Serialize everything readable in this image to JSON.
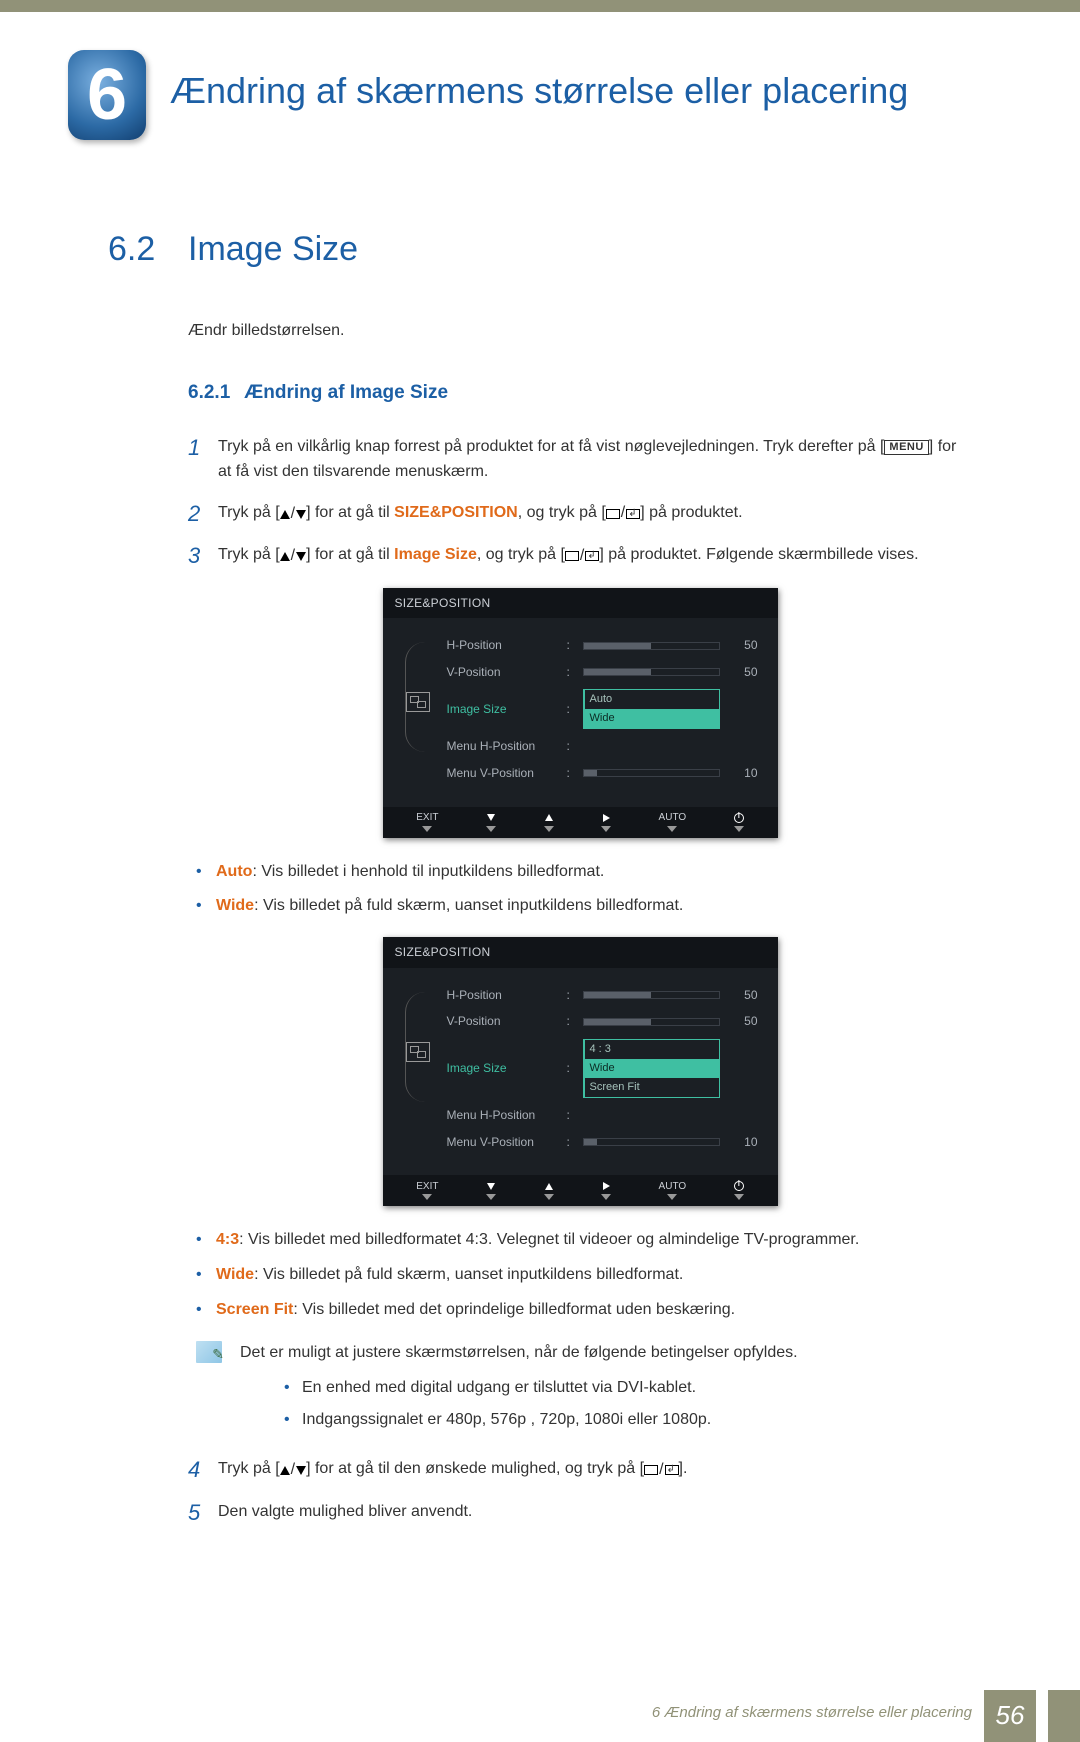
{
  "chapter": {
    "number": "6",
    "title": "Ændring af skærmens størrelse eller placering"
  },
  "section": {
    "number": "6.2",
    "title": "Image Size"
  },
  "intro": "Ændr billedstørrelsen.",
  "subsection": {
    "number": "6.2.1",
    "title": "Ændring af Image Size"
  },
  "steps": {
    "1": {
      "pre": "Tryk på en vilkårlig knap forrest på produktet for at få vist nøglevejledningen. Tryk derefter på [",
      "key": "MENU",
      "post": "] for at få vist den tilsvarende menuskærm."
    },
    "2": {
      "pre": "Tryk på [",
      "mid": "] for at gå til ",
      "target": "SIZE&POSITION",
      "mid2": ", og tryk på [",
      "post": "] på produktet."
    },
    "3": {
      "pre": "Tryk på [",
      "mid": "] for at gå til ",
      "target": "Image Size",
      "mid2": ", og tryk på [",
      "post": "] på produktet. Følgende skærmbillede vises."
    },
    "4": {
      "pre": "Tryk på [",
      "mid": "] for at gå til den ønskede mulighed, og tryk på [",
      "post": "]."
    },
    "5": "Den valgte mulighed bliver anvendt."
  },
  "osd_title": "SIZE&POSITION",
  "osd_rows": {
    "hpos": "H-Position",
    "vpos": "V-Position",
    "imgsize": "Image Size",
    "mhpos": "Menu H-Position",
    "mvpos": "Menu V-Position"
  },
  "osd_vals": {
    "hpos": "50",
    "vpos": "50",
    "mvpos": "10"
  },
  "osd1_opts": {
    "auto": "Auto",
    "wide": "Wide"
  },
  "osd2_opts": {
    "r43": "4 : 3",
    "wide": "Wide",
    "fit": "Screen Fit"
  },
  "osd_bottom": {
    "exit": "EXIT",
    "auto": "AUTO"
  },
  "bullets1": {
    "auto": {
      "label": "Auto",
      "text": ": Vis billedet i henhold til inputkildens billedformat."
    },
    "wide": {
      "label": "Wide",
      "text": ": Vis billedet på fuld skærm, uanset inputkildens billedformat."
    }
  },
  "bullets2": {
    "r43": {
      "label": "4:3",
      "text": ": Vis billedet med billedformatet 4:3. Velegnet til videoer og almindelige TV-programmer."
    },
    "wide": {
      "label": "Wide",
      "text": ": Vis billedet på fuld skærm, uanset inputkildens billedformat."
    },
    "fit": {
      "label": "Screen Fit",
      "text": ": Vis billedet med det oprindelige billedformat uden beskæring."
    }
  },
  "note": {
    "lead": "Det er muligt at justere skærmstørrelsen, når de følgende betingelser opfyldes.",
    "sub1": "En enhed med digital udgang er tilsluttet via DVI-kablet.",
    "sub2": "Indgangssignalet er 480p, 576p , 720p, 1080i eller 1080p."
  },
  "footer": {
    "text": "6 Ændring af skærmens størrelse eller placering",
    "page": "56"
  }
}
